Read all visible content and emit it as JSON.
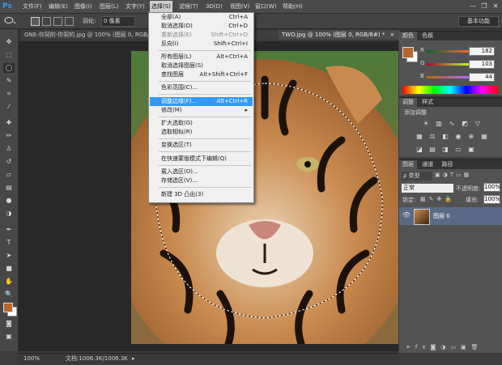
{
  "app": {
    "logo": "Ps"
  },
  "menubar": {
    "items": [
      "文件(F)",
      "编辑(E)",
      "图像(I)",
      "图层(L)",
      "文字(Y)",
      "选择(S)",
      "滤镜(T)",
      "3D(D)",
      "视图(V)",
      "窗口(W)",
      "帮助(H)"
    ],
    "active_index": 5
  },
  "window_controls": {
    "minimize": "—",
    "restore": "❐",
    "close": "✕"
  },
  "options_bar": {
    "feather_label": "羽化:",
    "feather_value": "0 像素",
    "workspace": "基本功能"
  },
  "tabs": [
    {
      "label": "ONE-你契的-你契的.jpg @ 100% (图层 0, RGB/8) *",
      "close": "×"
    },
    {
      "label": "TWO.jpg @ 100% (图层 0, RGB/8#) *",
      "close": "×"
    }
  ],
  "select_menu": {
    "items": [
      {
        "label": "全部(A)",
        "shortcut": "Ctrl+A",
        "disabled": false
      },
      {
        "label": "取消选择(D)",
        "shortcut": "Ctrl+D",
        "disabled": false
      },
      {
        "label": "重新选择(E)",
        "shortcut": "Shift+Ctrl+D",
        "disabled": true
      },
      {
        "label": "反向(I)",
        "shortcut": "Shift+Ctrl+I",
        "disabled": false
      },
      {
        "label": "所有图层(L)",
        "shortcut": "Alt+Ctrl+A",
        "disabled": false
      },
      {
        "label": "取消选择图层(S)",
        "shortcut": "",
        "disabled": false
      },
      {
        "label": "查找图层",
        "shortcut": "Alt+Shift+Ctrl+F",
        "disabled": false
      },
      {
        "label": "色彩范围(C)...",
        "shortcut": "",
        "disabled": false
      },
      {
        "label": "调整边缘(F)...",
        "shortcut": "Alt+Ctrl+R",
        "disabled": false,
        "highlighted": true
      },
      {
        "label": "修改(M)",
        "shortcut": "▸",
        "disabled": false
      },
      {
        "label": "扩大选取(G)",
        "shortcut": "",
        "disabled": false
      },
      {
        "label": "选取相似(R)",
        "shortcut": "",
        "disabled": false
      },
      {
        "label": "变换选区(T)",
        "shortcut": "",
        "disabled": false
      },
      {
        "label": "在快速蒙版模式下编辑(Q)",
        "shortcut": "",
        "disabled": false
      },
      {
        "label": "载入选区(O)...",
        "shortcut": "",
        "disabled": false
      },
      {
        "label": "存储选区(V)...",
        "shortcut": "",
        "disabled": false
      },
      {
        "label": "新建 3D 凸出(3)",
        "shortcut": "",
        "disabled": false
      }
    ]
  },
  "color_panel": {
    "tabs": [
      "颜色",
      "色板"
    ],
    "r_label": "R",
    "g_label": "G",
    "b_label": "B",
    "r": "182",
    "g": "103",
    "b": "44",
    "foreground": "#b6672c",
    "background": "#ffffff"
  },
  "adjust_panel": {
    "tabs": [
      "调整",
      "样式"
    ],
    "title": "添加调整"
  },
  "layers_panel": {
    "tabs": [
      "图层",
      "通道",
      "路径"
    ],
    "filter": "ρ 类型",
    "blend_mode": "正常",
    "opacity_label": "不透明度:",
    "opacity": "100%",
    "lock_label": "锁定:",
    "fill_label": "填充:",
    "fill": "100%",
    "layer_name": "图层 0"
  },
  "status_bar": {
    "zoom": "100%",
    "doc_info": "文档:1006.3K/1006.3K"
  },
  "colors": {
    "accent": "#3399ff",
    "panel": "#535353",
    "selected_layer": "#5a6a86"
  }
}
